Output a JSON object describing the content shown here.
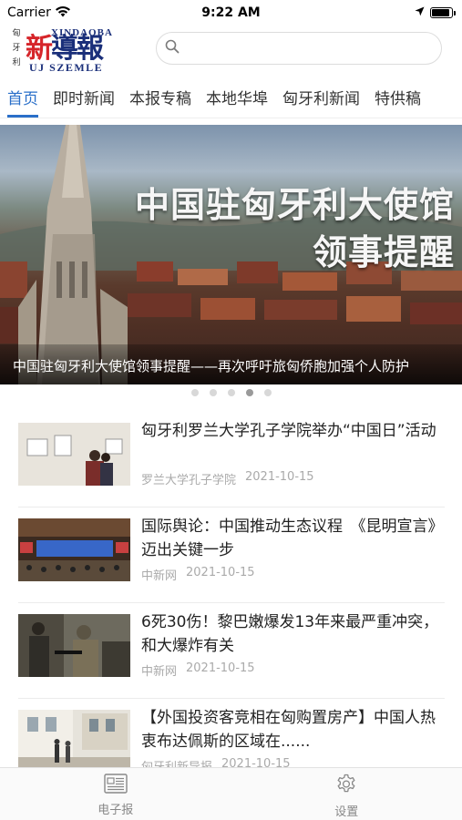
{
  "status_bar": {
    "carrier": "Carrier",
    "time": "9:22 AM",
    "battery_level": 0.9
  },
  "header": {
    "logo": {
      "side_chars": [
        "匈",
        "牙",
        "利"
      ],
      "latin_name": "XINDAOBA",
      "chinese_name": "新導報",
      "subtitle": "UJ SZEMLE"
    },
    "search": {
      "placeholder": ""
    }
  },
  "tabs": [
    {
      "label": "首页",
      "active": true
    },
    {
      "label": "即时新闻",
      "active": false
    },
    {
      "label": "本报专稿",
      "active": false
    },
    {
      "label": "本地华埠",
      "active": false
    },
    {
      "label": "匈牙利新闻",
      "active": false
    },
    {
      "label": "特供稿",
      "active": false
    }
  ],
  "banner": {
    "headline_line1": "中国驻匈牙利大使馆",
    "headline_line2": "领事提醒",
    "caption": "中国驻匈牙利大使馆领事提醒——再次呼吁旅匈侨胞加强个人防护",
    "slide_count": 5,
    "active_index": 3
  },
  "news": [
    {
      "title": "匈牙利罗兰大学孔子学院举办“中国日”活动",
      "source": "罗兰大学孔子学院",
      "date": "2021-10-15",
      "thumb": "exhibition"
    },
    {
      "title": "国际舆论：中国推动生态议程　《昆明宣言》迈出关键一步",
      "source": "中新网",
      "date": "2021-10-15",
      "thumb": "conference"
    },
    {
      "title": "6死30伤！黎巴嫩爆发13年来最严重冲突，和大爆炸有关",
      "source": "中新网",
      "date": "2021-10-15",
      "thumb": "soldiers"
    },
    {
      "title": "【外国投资客竞相在匈购置房产】中国人热衷布达佩斯的区域在......",
      "source": "匈牙利新导报",
      "date": "2021-10-15",
      "thumb": "street"
    }
  ],
  "tabbar": [
    {
      "label": "电子报",
      "icon": "newspaper-icon"
    },
    {
      "label": "设置",
      "icon": "gear-icon"
    }
  ],
  "colors": {
    "accent": "#2a6fc9",
    "logo_red": "#d6252a",
    "logo_blue": "#1a2f7a"
  }
}
